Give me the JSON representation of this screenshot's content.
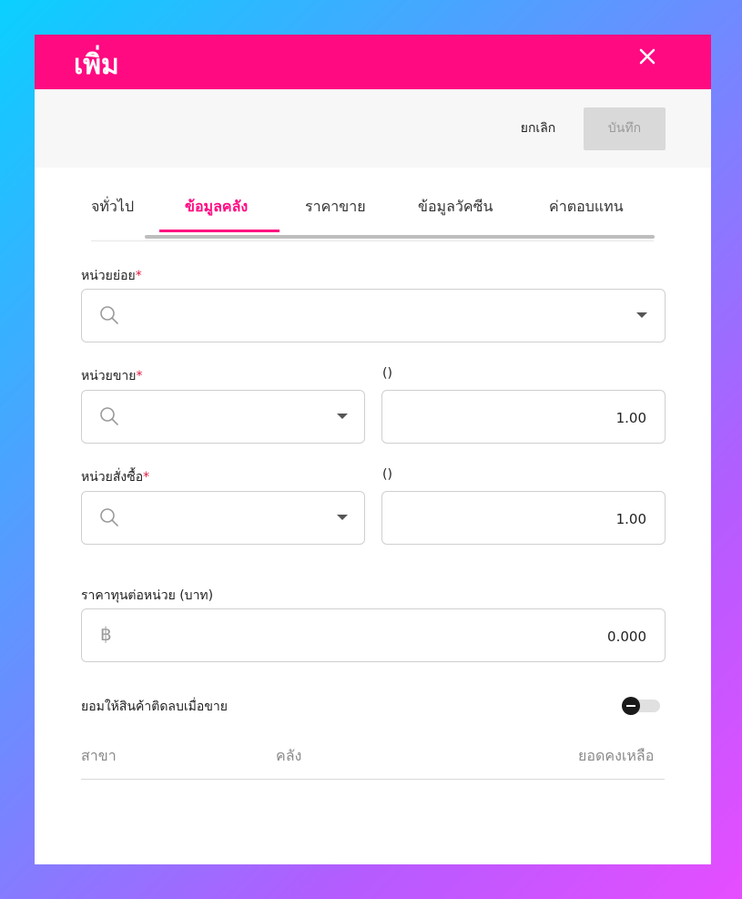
{
  "dialog": {
    "title": "เพิ่ม"
  },
  "actions": {
    "cancel_label": "ยกเลิก",
    "save_label": "บันทึก"
  },
  "tabs": [
    {
      "label": "ข้อมูลทั่วไป",
      "visible_text": "จทั่วไป",
      "active": false
    },
    {
      "label": "ข้อมูลคลัง",
      "active": true
    },
    {
      "label": "ราคาขาย",
      "active": false
    },
    {
      "label": "ข้อมูลวัคซีน",
      "active": false
    },
    {
      "label": "ค่าตอบแทน",
      "active": false
    }
  ],
  "form": {
    "sub_unit": {
      "label": "หน่วยย่อย",
      "required_mark": "*",
      "value": ""
    },
    "sale_unit": {
      "label": "หน่วยขาย",
      "required_mark": "*",
      "value": "",
      "ratio_label": "()",
      "ratio_value": "1.00"
    },
    "purchase_unit": {
      "label": "หน่วยสั่งซื้อ",
      "required_mark": "*",
      "value": "",
      "ratio_label": "()",
      "ratio_value": "1.00"
    },
    "cost": {
      "label": "ราคาทุนต่อหน่วย (บาท)",
      "currency_symbol": "฿",
      "value": "0.000"
    },
    "allow_negative": {
      "label": "ยอมให้สินค้าติดลบเมื่อขาย",
      "enabled": false
    }
  },
  "stock_table": {
    "columns": [
      "สาขา",
      "คลัง",
      "ยอดคงเหลือ"
    ],
    "rows": []
  },
  "colors": {
    "accent": "#ff0a81",
    "required": "#e0143c"
  },
  "icons": [
    "close-icon",
    "search-icon",
    "chevron-down-icon",
    "baht-icon",
    "toggle-switch"
  ]
}
